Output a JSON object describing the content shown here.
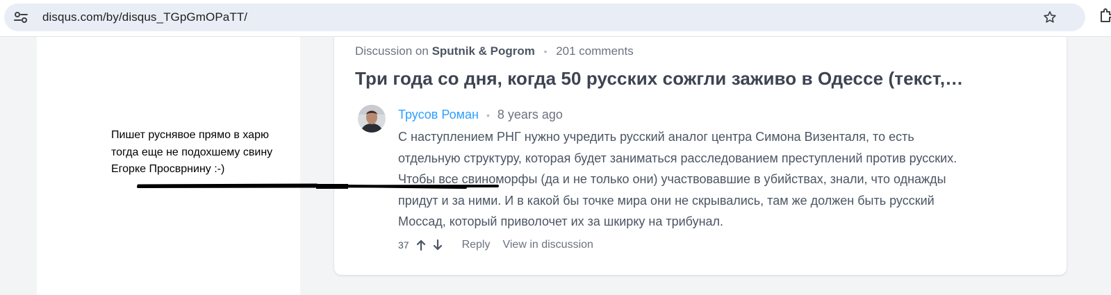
{
  "browser": {
    "url": "disqus.com/by/disqus_TGpGmOPaTT/"
  },
  "annotation": {
    "lines": [
      "Пишет руснявое прямо в харю",
      "тогда еще не подохшему свину",
      "Егорке Просврнину :-)"
    ]
  },
  "discussion": {
    "prefix": "Discussion on",
    "site": "Sputnik & Pogrom",
    "separator": "•",
    "comments_count": "201 comments",
    "title": "Три года со дня, когда 50 русских сожгли заживо в Одессе (текст,…"
  },
  "comment": {
    "author": "Трусов Роман",
    "separator": "•",
    "time": "8 years ago",
    "body_lines": [
      "С наступлением РНГ нужно учредить русский аналог центра Симона Визенталя, то есть",
      "отдельную структуру, которая будет заниматься расследованием преступлений против русских.",
      "Чтобы все свиноморфы (да и не только они) участвовавшие в убийствах, знали, что однажды",
      "придут и за ними. И в какой бы точке мира они не скрывались, там же должен быть русский",
      "Моссад, который приволочет их за шкирку на трибунал."
    ],
    "votes": "37",
    "reply_label": "Reply",
    "view_label": "View in discussion"
  },
  "icons": {
    "site_info": "site-info-icon",
    "bookmark": "star-icon",
    "extensions": "puzzle-icon",
    "upvote": "arrow-up-icon",
    "downvote": "arrow-down-icon"
  },
  "colors": {
    "author_link": "#2e9fff",
    "text": "#4b5563",
    "muted": "#6b7280",
    "omnibox": "#e9eef6",
    "page_bg": "#f3f4f6"
  }
}
